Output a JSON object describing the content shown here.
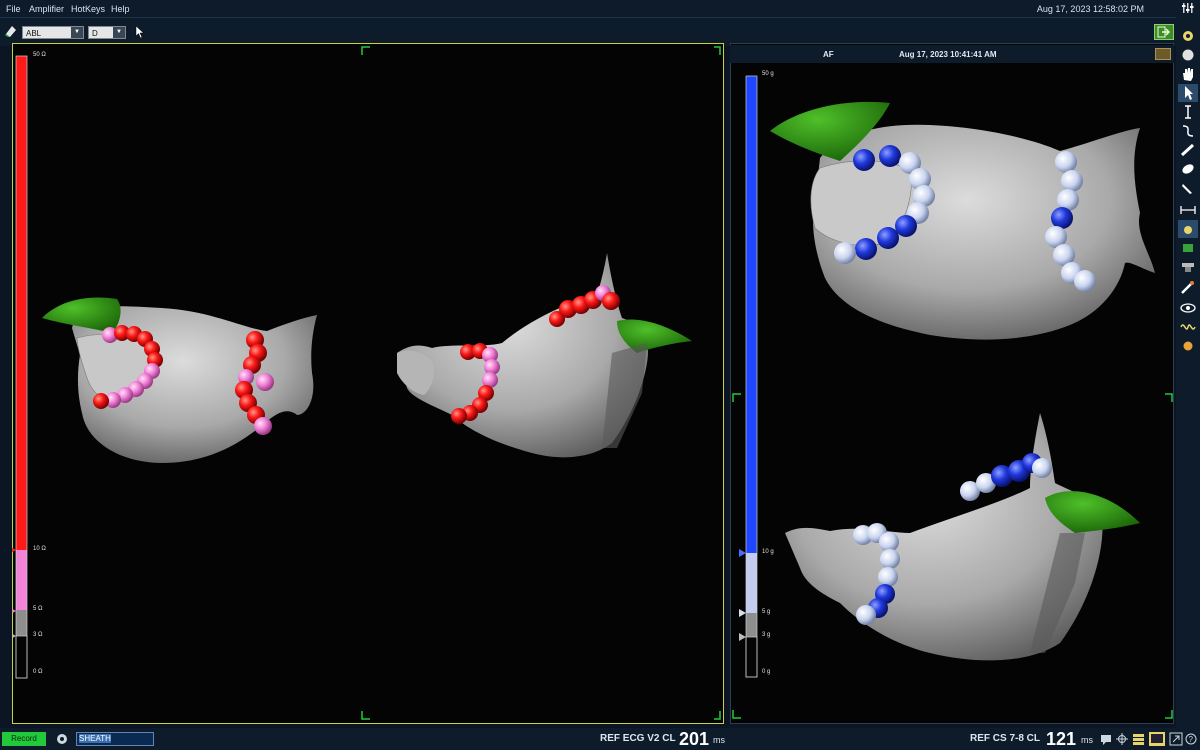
{
  "menu": [
    "File",
    "Amplifier",
    "HotKeys",
    "Help"
  ],
  "clock": "Aug 17, 2023 12:58:02 PM",
  "toolbar": {
    "catheter": "ABL",
    "mode": "D"
  },
  "left_scale": {
    "max": "50 Ω",
    "t1": "10 Ω",
    "t2": "5 Ω",
    "t3": "3 Ω",
    "min": "0 Ω"
  },
  "right_panel": {
    "rhythm": "AF",
    "timestamp": "Aug 17, 2023 10:41:41 AM"
  },
  "right_scale": {
    "max": "50 g",
    "t1": "10 g",
    "t2": "5 g",
    "t3": "3 g",
    "min": "0 g"
  },
  "status": {
    "record_label": "Record",
    "sheath_value": "SHEATH",
    "left_cl_label": "REF ECG V2 CL",
    "left_cl_value": "201",
    "left_cl_unit": "ms",
    "right_cl_label": "REF CS  7-8 CL",
    "right_cl_value": "121",
    "right_cl_unit": "ms"
  },
  "colors": {
    "left_accent": "#ff1a1a",
    "right_accent": "#1f47ff",
    "lesion_red": "#ff1a1a",
    "lesion_pink": "#f283d8",
    "lesion_blue": "#1f38dd",
    "appendage_green": "#2f8f16",
    "record_green": "#22c93a"
  },
  "icons": [
    "eraser-icon",
    "pointer-icon",
    "mixer-icon",
    "export-icon",
    "gear-icon"
  ]
}
